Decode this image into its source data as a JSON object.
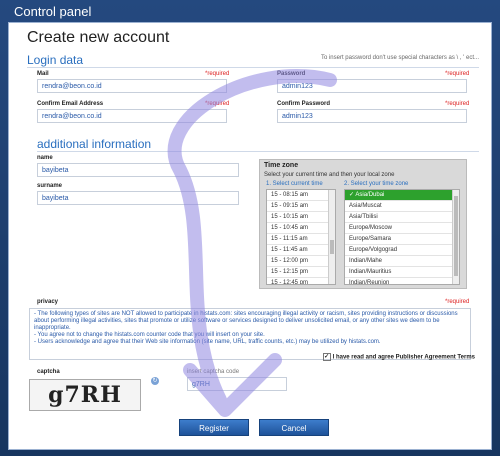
{
  "window": {
    "title": "Control panel"
  },
  "page": {
    "heading": "Create new account",
    "hint": "To insert password don't use special characters as \\ , ' ect..."
  },
  "login": {
    "section": "Login data",
    "mail": {
      "label": "Mail",
      "required": "*required",
      "value": "rendra@beon.co.id"
    },
    "password": {
      "label": "Password",
      "required": "*required",
      "value": "admin123"
    },
    "confirm_email": {
      "label": "Confirm Email Address",
      "required": "*required",
      "value": "rendra@beon.co.id"
    },
    "confirm_password": {
      "label": "Confirm Password",
      "required": "*required",
      "value": "admin123"
    }
  },
  "additional": {
    "section": "additional information",
    "name": {
      "label": "name",
      "value": "bayibeta"
    },
    "surname": {
      "label": "surname",
      "value": "bayibeta"
    }
  },
  "timezone": {
    "title": "Time zone",
    "subtitle": "Select your current time and then your local zone",
    "col1": "1. Select current time",
    "col2": "2. Select your time zone",
    "times": [
      "15 - 08:15 am",
      "15 - 09:15 am",
      "15 - 10:15 am",
      "15 - 10:45 am",
      "15 - 11:15 am",
      "15 - 11:45 am",
      "15 - 12:00 pm",
      "15 - 12:15 pm",
      "15 - 12:45 pm"
    ],
    "zones": [
      "✓ Asia/Dubai",
      "Asia/Muscat",
      "Asia/Tbilisi",
      "Europe/Moscow",
      "Europe/Samara",
      "Europe/Volgograd",
      "Indian/Mahe",
      "Indian/Mauritius",
      "Indian/Reunion"
    ]
  },
  "privacy": {
    "label": "privacy",
    "required": "*required",
    "lines": [
      "- The following types of sites are NOT allowed to participate in histats.com: sites encouraging illegal activity or racism, sites providing instructions or discussions about performing illegal activities, sites that promote or utilize software or services designed to deliver unsolicited email, or any other sites we deem to be inappropriate.",
      "- You agree not to change the histats.com counter code that you will insert on your site.",
      "- Users acknowledge and agree that their Web site information (site name, URL, traffic counts, etc.) may be utilized by histats.com."
    ],
    "agree": "I have read and agree Publisher Agreement Terms",
    "agree_mark": "✓"
  },
  "captcha": {
    "label": "captcha",
    "image_text": "g7RH",
    "input_label": "insert captcha code",
    "input_value": "g7RH"
  },
  "buttons": {
    "register": "Register",
    "cancel": "Cancel"
  },
  "colors": {
    "accent": "#2a6fbf",
    "button": "#2a65b0",
    "selected": "#2da12d",
    "scribble": "#8f86e0"
  }
}
